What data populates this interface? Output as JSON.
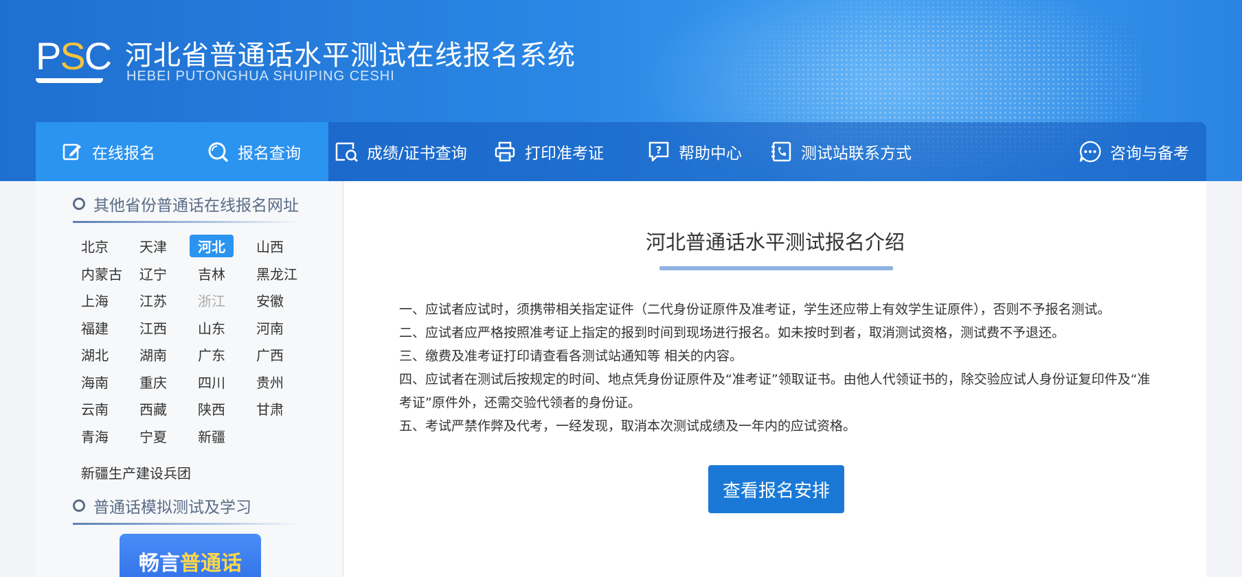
{
  "header": {
    "logo_text_a": "P",
    "logo_text_b": "S",
    "logo_text_c": "C",
    "title_cn": "河北省普通话水平测试在线报名系统",
    "title_en": "HEBEI PUTONGHUA SHUIPING CESHI"
  },
  "nav": [
    {
      "label": "在线报名",
      "icon": "edit-icon",
      "active": true
    },
    {
      "label": "报名查询",
      "icon": "search-icon",
      "active": true
    },
    {
      "label": "成绩/证书查询",
      "icon": "certificate-search-icon",
      "active": false
    },
    {
      "label": "打印准考证",
      "icon": "printer-icon",
      "active": false
    },
    {
      "label": "帮助中心",
      "icon": "help-icon",
      "active": false
    },
    {
      "label": "测试站联系方式",
      "icon": "phone-contact-icon",
      "active": false
    },
    {
      "label": "咨询与备考",
      "icon": "chat-icon",
      "active": false
    }
  ],
  "sidebar": {
    "section1_title": "其他省份普通话在线报名网址",
    "provinces": [
      [
        "北京",
        "天津",
        "河北",
        "山西"
      ],
      [
        "内蒙古",
        "辽宁",
        "吉林",
        "黑龙江"
      ],
      [
        "上海",
        "江苏",
        "浙江",
        "安徽"
      ],
      [
        "福建",
        "江西",
        "山东",
        "河南"
      ],
      [
        "湖北",
        "湖南",
        "广东",
        "广西"
      ],
      [
        "海南",
        "重庆",
        "四川",
        "贵州"
      ],
      [
        "云南",
        "西藏",
        "陕西",
        "甘肃"
      ],
      [
        "青海",
        "宁夏",
        "新疆"
      ]
    ],
    "active_province": "河北",
    "disabled_province": "浙江",
    "bingtuan": "新疆生产建设兵团",
    "section2_title": "普通话模拟测试及学习",
    "promo_a": "畅言",
    "promo_b": "普通话"
  },
  "main": {
    "title": "河北普通话水平测试报名介绍",
    "rules": [
      "一、应试者应试时，须携带相关指定证件（二代身份证原件及准考证，学生还应带上有效学生证原件），否则不予报名测试。",
      "二、应试者应严格按照准考证上指定的报到时间到现场进行报名。如未按时到者，取消测试资格，测试费不予退还。",
      "三、缴费及准考证打印请查看各测试站通知等 相关的内容。",
      "四、应试者在测试后按规定的时间、地点凭身份证原件及“准考证”领取证书。由他人代领证书的，除交验应试人身份证复印件及“准考证”原件外，还需交验代领者的身份证。",
      "五、考试严禁作弊及代考，一经发现，取消本次测试成绩及一年内的应试资格。"
    ],
    "button_label": "查看报名安排"
  },
  "colors": {
    "header_blue": "#2a86e4",
    "nav_active": "#2b93f0",
    "button_blue": "#1a79d6",
    "logo_yellow": "#f5c33b"
  }
}
